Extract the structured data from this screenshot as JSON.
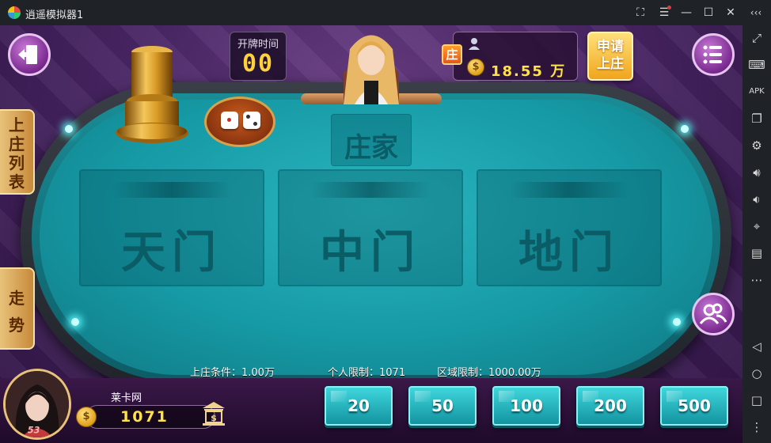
{
  "window": {
    "title": "逍遥模拟器1"
  },
  "game": {
    "timer": {
      "label": "开牌时间",
      "value": "00"
    },
    "banker_zone_label": "庄家",
    "zones": [
      {
        "label": "天门"
      },
      {
        "label": "中门"
      },
      {
        "label": "地门"
      }
    ],
    "banker": {
      "badge": "庄",
      "amount": "18.55 万"
    },
    "apply_banker": {
      "line1": "申请",
      "line2": "上庄"
    },
    "left_tabs": {
      "banker_list": [
        "上",
        "庄",
        "列",
        "表"
      ],
      "trend": [
        "走",
        "势"
      ]
    },
    "info": {
      "banker_condition": "上庄条件：1.00万",
      "personal_limit": "个人限制：1071",
      "area_limit": "区域限制：1000.00万"
    },
    "player": {
      "name": "莱卡网",
      "money": "1071",
      "avatar_badge": "53"
    },
    "chips": [
      "20",
      "50",
      "100",
      "200",
      "500"
    ]
  },
  "colors": {
    "accent_gold": "#ffe14a",
    "felt": "#169aa5",
    "background": "#4a2666"
  }
}
